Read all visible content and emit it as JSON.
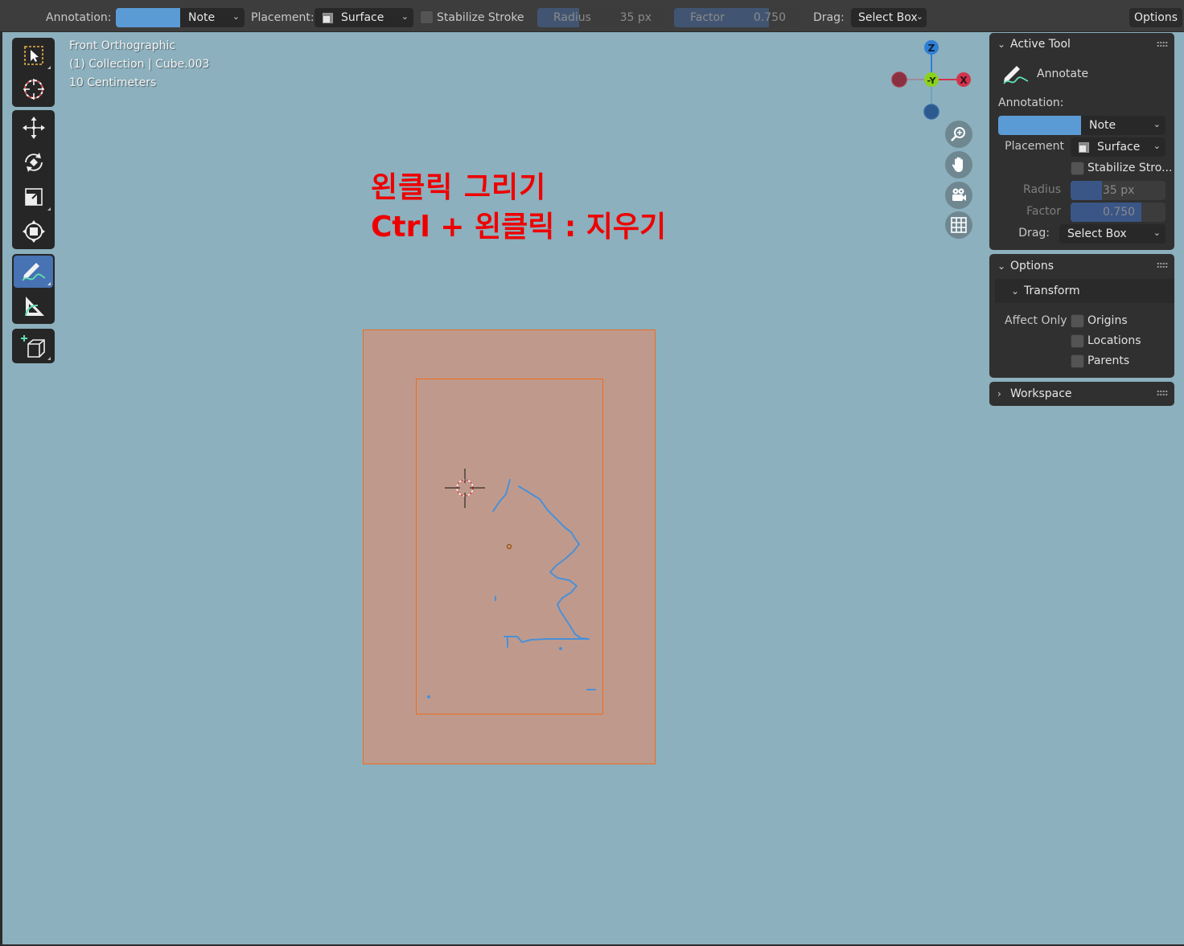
{
  "header": {
    "annotation_label": "Annotation:",
    "annotation_color": "#5b9bd5",
    "note_value": "Note",
    "placement_label": "Placement:",
    "placement_value": "Surface",
    "stabilize_label": "Stabilize Stroke",
    "radius_label": "Radius",
    "radius_value": "35 px",
    "factor_label": "Factor",
    "factor_value": "0.750",
    "drag_label": "Drag:",
    "drag_value": "Select Box",
    "options_label": "Options"
  },
  "toolbar": {
    "tools": [
      {
        "name": "select-box",
        "icon": "select-box-icon",
        "active": false
      },
      {
        "name": "cursor",
        "icon": "cursor-icon",
        "active": false
      },
      {
        "name": "move",
        "icon": "move-icon",
        "active": false
      },
      {
        "name": "rotate",
        "icon": "rotate-icon",
        "active": false
      },
      {
        "name": "scale",
        "icon": "scale-icon",
        "active": false
      },
      {
        "name": "transform",
        "icon": "transform-icon",
        "active": false
      },
      {
        "name": "annotate",
        "icon": "annotate-icon",
        "active": true
      },
      {
        "name": "measure",
        "icon": "measure-icon",
        "active": false
      },
      {
        "name": "add-cube",
        "icon": "add-cube-icon",
        "active": false
      }
    ]
  },
  "viewport": {
    "view_name": "Front Orthographic",
    "collection": "(1) Collection | Cube.003",
    "scale": "10 Centimeters",
    "note_line1": "왼클릭 그리기",
    "note_line2": "Ctrl + 왼클릭 : 지우기",
    "note_color": "#ee0000",
    "background": "#8cb0bd"
  },
  "gizmo": {
    "z_label": "Z",
    "y_label": "-Y",
    "x_label": "X",
    "z_color": "#2e7fd6",
    "y_color": "#8bd11c",
    "x_color": "#d2334d",
    "nav_icons": [
      "zoom-icon",
      "hand-pan-icon",
      "camera-icon",
      "grid-icon"
    ]
  },
  "sidebar": {
    "active_tool": {
      "title": "Active Tool",
      "tool_name": "Annotate",
      "annotation_label": "Annotation:",
      "note_value": "Note",
      "placement_label": "Placement",
      "placement_value": "Surface",
      "stabilize_label": "Stabilize Stro...",
      "radius_label": "Radius",
      "radius_value": "35 px",
      "factor_label": "Factor",
      "factor_value": "0.750",
      "drag_label": "Drag:",
      "drag_value": "Select Box"
    },
    "options": {
      "title": "Options",
      "transform_title": "Transform",
      "affect_only_label": "Affect Only",
      "origins_label": "Origins",
      "locations_label": "Locations",
      "parents_label": "Parents"
    },
    "workspace": {
      "title": "Workspace"
    }
  }
}
